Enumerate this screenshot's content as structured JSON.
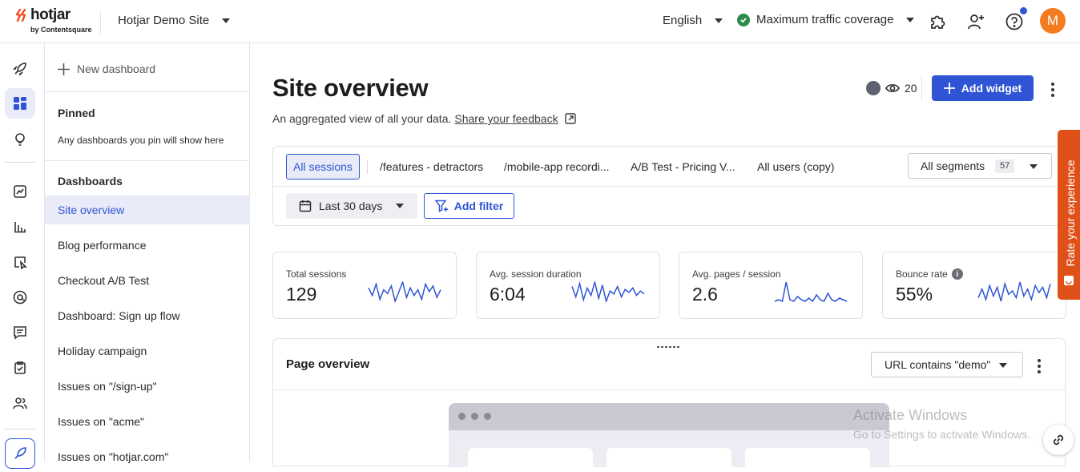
{
  "header": {
    "logo_text": "hotjar",
    "logo_sub": "by Contentsquare",
    "site": "Hotjar Demo Site",
    "language": "English",
    "traffic": "Maximum traffic coverage",
    "avatar_initial": "M"
  },
  "sidebar": {
    "new_dashboard": "New dashboard",
    "pinned_heading": "Pinned",
    "pinned_note": "Any dashboards you pin will show here",
    "dashboards_heading": "Dashboards",
    "items": [
      {
        "label": "Site overview",
        "active": true
      },
      {
        "label": "Blog performance"
      },
      {
        "label": "Checkout A/B Test"
      },
      {
        "label": "Dashboard: Sign up flow"
      },
      {
        "label": "Holiday campaign"
      },
      {
        "label": "Issues on \"/sign-up\""
      },
      {
        "label": "Issues on \"acme\""
      },
      {
        "label": "Issues on \"hotjar.com\""
      }
    ]
  },
  "main": {
    "title": "Site overview",
    "subtitle": "An aggregated view of all your data.",
    "feedback_link": "Share your feedback",
    "viewer_count": "20",
    "add_widget": "Add widget",
    "segment_tabs": [
      "All sessions",
      "/features - detractors",
      "/mobile-app recordi...",
      "A/B Test - Pricing V...",
      "All users (copy)"
    ],
    "segments_select": "All segments",
    "segments_count": "57",
    "date_range": "Last 30 days",
    "add_filter": "Add filter",
    "kpis": [
      {
        "label": "Total sessions",
        "value": "129",
        "spark": [
          10,
          6,
          12,
          4,
          9,
          7,
          11,
          3,
          8,
          13,
          5,
          10,
          6,
          9,
          4,
          12,
          8,
          11,
          5,
          9
        ]
      },
      {
        "label": "Avg. session duration",
        "value": "6:04",
        "spark": [
          12,
          5,
          14,
          3,
          11,
          6,
          15,
          4,
          13,
          2,
          9,
          7,
          12,
          5,
          10,
          8,
          11,
          6,
          9,
          7
        ]
      },
      {
        "label": "Avg. pages / session",
        "value": "2.6",
        "spark": [
          3,
          4,
          3,
          15,
          4,
          3,
          6,
          4,
          3,
          5,
          3,
          7,
          4,
          3,
          8,
          4,
          3,
          5,
          4,
          3
        ]
      },
      {
        "label": "Bounce rate",
        "value": "55%",
        "spark": [
          5,
          10,
          4,
          12,
          6,
          11,
          3,
          13,
          7,
          9,
          5,
          14,
          6,
          10,
          4,
          12,
          8,
          11,
          5,
          13
        ]
      }
    ],
    "page_overview_title": "Page overview",
    "url_filter": "URL contains \"demo\""
  },
  "rate_tab": "Rate your experience",
  "watermark": {
    "line1": "Activate Windows",
    "line2": "Go to Settings to activate Windows."
  },
  "colors": {
    "accent": "#2f55d4",
    "rate_tab": "#e0511a",
    "avatar": "#f47b20",
    "success": "#2c8a4a"
  }
}
